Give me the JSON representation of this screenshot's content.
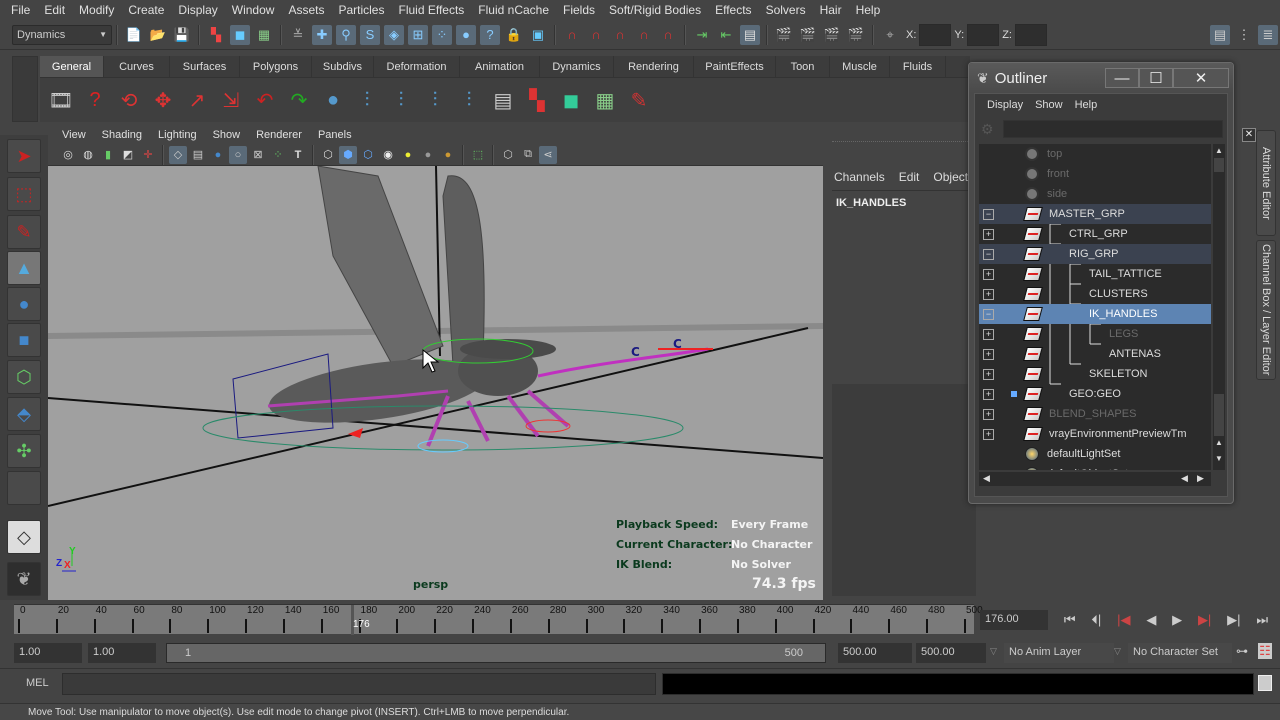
{
  "menubar": [
    "File",
    "Edit",
    "Modify",
    "Create",
    "Display",
    "Window",
    "Assets",
    "Particles",
    "Fluid Effects",
    "Fluid nCache",
    "Fields",
    "Soft/Rigid Bodies",
    "Effects",
    "Solvers",
    "Hair",
    "Help"
  ],
  "status_line": {
    "mode": "Dynamics",
    "x_label": "X:",
    "y_label": "Y:",
    "z_label": "Z:",
    "x_value": "",
    "y_value": "",
    "z_value": ""
  },
  "shelf": {
    "tabs": [
      "General",
      "Curves",
      "Surfaces",
      "Polygons",
      "Subdivs",
      "Deformation",
      "Animation",
      "Dynamics",
      "Rendering",
      "PaintEffects",
      "Toon",
      "Muscle",
      "Fluids"
    ],
    "active_tab": "General",
    "icons": [
      "film-reel-icon",
      "help-icon",
      "camera-tumble-icon",
      "camera-track-icon",
      "camera-dolly-icon",
      "camera-zoom-icon",
      "undo-icon",
      "redo-icon",
      "delete-history-icon",
      "hierarchy-icon",
      "hierarchy-icon",
      "hierarchy-icon",
      "hierarchy-icon",
      "hypergraph-icon",
      "select-object-icon",
      "select-component-icon",
      "select-uv-icon",
      "paint-select-icon"
    ]
  },
  "viewport": {
    "menu": [
      "View",
      "Shading",
      "Lighting",
      "Show",
      "Renderer",
      "Panels"
    ],
    "camera_name": "persp",
    "hud": [
      {
        "label": "Playback Speed:",
        "value": "Every Frame"
      },
      {
        "label": "Current Character:",
        "value": "No Character"
      },
      {
        "label": "IK Blend:",
        "value": "No Solver"
      }
    ],
    "fps": "74.3 fps",
    "axis": {
      "x": "X",
      "y": "Y",
      "z": "Z"
    },
    "curve_labels": [
      "C",
      "C"
    ]
  },
  "toolbox": [
    "select-tool",
    "lasso-tool",
    "paint-select-tool",
    "move-tool",
    "rotate-tool",
    "scale-tool",
    "universal-manipulator",
    "soft-modification-tool",
    "show-manipulator-tool",
    "last-tool",
    "quick-layout-single",
    "maya-logo"
  ],
  "channel_box": {
    "menu": [
      "Channels",
      "Edit",
      "Object"
    ],
    "selected_node": "IK_HANDLES"
  },
  "outliner": {
    "title": "Outliner",
    "menu": [
      "Display",
      "Show",
      "Help"
    ],
    "filter_value": "",
    "rows": [
      {
        "label": "top",
        "type": "camera",
        "dim": true,
        "expand": "",
        "indent": 0
      },
      {
        "label": "front",
        "type": "camera",
        "dim": true,
        "expand": "",
        "indent": 0
      },
      {
        "label": "side",
        "type": "camera",
        "dim": true,
        "expand": "",
        "indent": 0
      },
      {
        "label": "MASTER_GRP",
        "type": "transform",
        "dim": false,
        "expand": "-",
        "indent": 0,
        "state": "highlight"
      },
      {
        "label": "CTRL_GRP",
        "type": "transform",
        "dim": false,
        "expand": "+",
        "indent": 1
      },
      {
        "label": "RIG_GRP",
        "type": "transform",
        "dim": false,
        "expand": "-",
        "indent": 1,
        "state": "highlight"
      },
      {
        "label": "TAIL_TATTICE",
        "type": "transform",
        "dim": false,
        "expand": "+",
        "indent": 2
      },
      {
        "label": "CLUSTERS",
        "type": "transform",
        "dim": false,
        "expand": "+",
        "indent": 2
      },
      {
        "label": "IK_HANDLES",
        "type": "transform",
        "dim": false,
        "expand": "-",
        "indent": 2,
        "state": "selected"
      },
      {
        "label": "LEGS",
        "type": "transform",
        "dim": true,
        "expand": "+",
        "indent": 3
      },
      {
        "label": "ANTENAS",
        "type": "transform",
        "dim": false,
        "expand": "+",
        "indent": 3
      },
      {
        "label": "SKELETON",
        "type": "transform",
        "dim": false,
        "expand": "+",
        "indent": 2
      },
      {
        "label": "GEO:GEO",
        "type": "transform",
        "dim": false,
        "expand": "+",
        "indent": 1,
        "referenced": true
      },
      {
        "label": "BLEND_SHAPES",
        "type": "transform",
        "dim": true,
        "expand": "+",
        "indent": 0
      },
      {
        "label": "vrayEnvironmentPreviewTm",
        "type": "transform",
        "dim": false,
        "expand": "+",
        "indent": 0
      },
      {
        "label": "defaultLightSet",
        "type": "set",
        "dim": false,
        "expand": "",
        "indent": 0
      },
      {
        "label": "defaultObjectSet",
        "type": "set",
        "dim": false,
        "expand": "",
        "indent": 0
      }
    ]
  },
  "side_tabs": [
    "Attribute Editor",
    "Channel Box / Layer Editor"
  ],
  "timeline": {
    "ticks": [
      0,
      20,
      40,
      60,
      80,
      100,
      120,
      140,
      160,
      180,
      200,
      220,
      240,
      260,
      280,
      300,
      320,
      340,
      360,
      380,
      400,
      420,
      440,
      460,
      480,
      500
    ],
    "range_min": 0,
    "range_max": 500,
    "current_frame_marker": "176",
    "current_frame_field": "176.00",
    "playback_buttons": [
      "go-to-start",
      "step-back-key",
      "step-back-frame",
      "play-backwards",
      "play-forwards",
      "step-forward-frame",
      "step-forward-key",
      "go-to-end"
    ]
  },
  "range_slider": {
    "start_time": "1.00",
    "playback_start": "1.00",
    "slider_start_label": "1",
    "slider_end_label": "500",
    "playback_end": "500.00",
    "end_time": "500.00",
    "anim_layer": "No Anim Layer",
    "character_set": "No Character Set"
  },
  "command_line": {
    "label": "MEL",
    "input_value": "",
    "result_value": ""
  },
  "help_line": "Move Tool: Use manipulator to move object(s). Use edit mode to change pivot (INSERT).  Ctrl+LMB to move perpendicular."
}
